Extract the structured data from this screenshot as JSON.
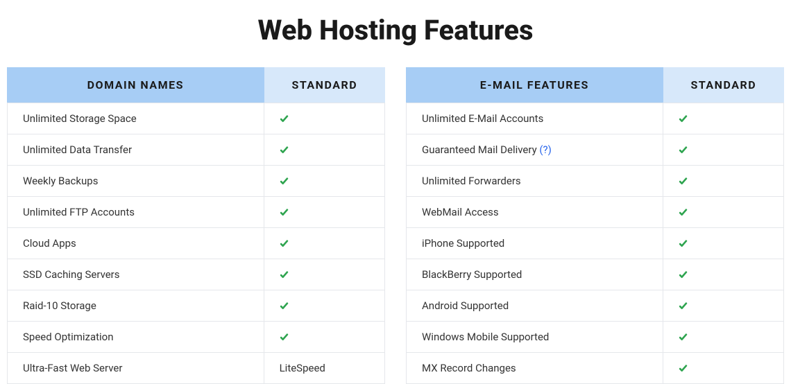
{
  "page_title": "Web Hosting Features",
  "tables": [
    {
      "header_feature": "DOMAIN NAMES",
      "header_plan": "STANDARD",
      "rows": [
        {
          "label": "Unlimited Storage Space",
          "value_type": "check"
        },
        {
          "label": "Unlimited Data Transfer",
          "value_type": "check"
        },
        {
          "label": "Weekly Backups",
          "value_type": "check"
        },
        {
          "label": "Unlimited FTP Accounts",
          "value_type": "check"
        },
        {
          "label": "Cloud Apps",
          "value_type": "check"
        },
        {
          "label": "SSD Caching Servers",
          "value_type": "check"
        },
        {
          "label": "Raid-10 Storage",
          "value_type": "check"
        },
        {
          "label": "Speed Optimization",
          "value_type": "check"
        },
        {
          "label": "Ultra-Fast Web Server",
          "value_type": "text",
          "value": "LiteSpeed"
        }
      ]
    },
    {
      "header_feature": "E-MAIL FEATURES",
      "header_plan": "STANDARD",
      "rows": [
        {
          "label": "Unlimited E-Mail Accounts",
          "value_type": "check"
        },
        {
          "label": "Guaranteed Mail Delivery",
          "has_help": true,
          "help_text": "(?)",
          "value_type": "check"
        },
        {
          "label": "Unlimited Forwarders",
          "value_type": "check"
        },
        {
          "label": "WebMail Access",
          "value_type": "check"
        },
        {
          "label": "iPhone Supported",
          "value_type": "check"
        },
        {
          "label": "BlackBerry Supported",
          "value_type": "check"
        },
        {
          "label": "Android Supported",
          "value_type": "check"
        },
        {
          "label": "Windows Mobile Supported",
          "value_type": "check"
        },
        {
          "label": "MX Record Changes",
          "value_type": "check"
        }
      ]
    }
  ]
}
